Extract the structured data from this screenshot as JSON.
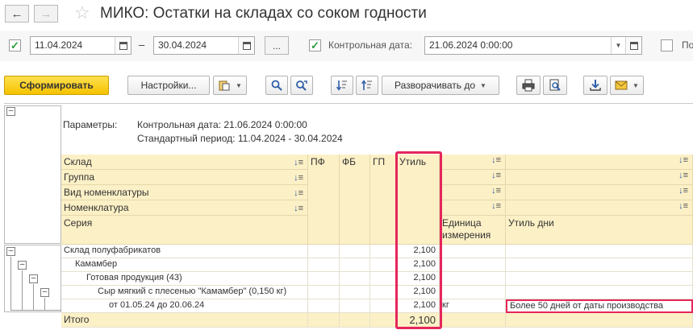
{
  "window": {
    "title": "МИКО: Остатки на складах со соком годности"
  },
  "period": {
    "date_from": "11.04.2024",
    "date_to": "30.04.2024",
    "dash": "–",
    "more_label": "...",
    "control_date_label": "Контрольная дата:",
    "control_date_value": "21.06.2024  0:00:00",
    "extra_label": "По"
  },
  "toolbar": {
    "generate_label": "Сформировать",
    "settings_label": "Настройки...",
    "expand_label": "Разворачивать до"
  },
  "report": {
    "params_label": "Параметры:",
    "param_control": "Контрольная дата: 21.06.2024 0:00:00",
    "param_period": "Стандартный период: 11.04.2024 - 30.04.2024",
    "group_headers": [
      "Склад",
      "Группа",
      "Вид номенклатуры",
      "Номенклатура",
      "Серия"
    ],
    "columns": {
      "pf": "ПФ",
      "fb": "ФБ",
      "gp": "ГП",
      "util": "Утиль",
      "unit": "Единица измерения",
      "util_days": "Утиль дни"
    },
    "rows": [
      {
        "name": "Склад полуфабрикатов",
        "util": "2,100",
        "unit": "",
        "util_days": ""
      },
      {
        "name": "Камамбер",
        "util": "2,100",
        "unit": "",
        "util_days": ""
      },
      {
        "name": "Готовая продукция (43)",
        "util": "2,100",
        "unit": "",
        "util_days": ""
      },
      {
        "name": "Сыр мягкий с плесенью \"Камамбер\" (0,150 кг)",
        "util": "2,100",
        "unit": "",
        "util_days": ""
      },
      {
        "name": "от 01.05.24 до 20.06.24",
        "util": "2,100",
        "unit": "кг",
        "util_days": "Более 50 дней от даты производства"
      }
    ],
    "total": {
      "label": "Итого",
      "util": "2,100"
    }
  },
  "colors": {
    "header_bg": "#fcf0c6",
    "highlight": "#e5265b",
    "primary_button": "#f5c200"
  }
}
